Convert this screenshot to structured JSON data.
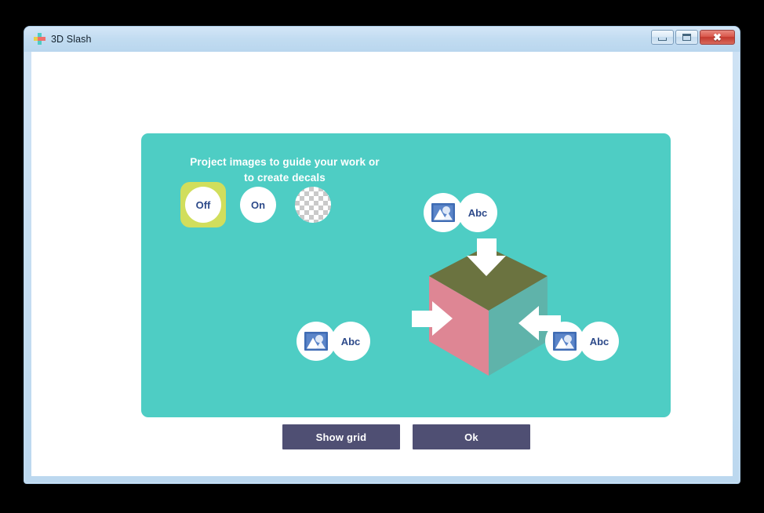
{
  "window": {
    "title": "3D Slash",
    "logo_icon": "3d-slash-pixel-logo",
    "controls": {
      "minimize": {
        "icon": "minimize-icon",
        "label": ""
      },
      "maximize": {
        "icon": "maximize-icon",
        "label": ""
      },
      "close": {
        "icon": "close-icon",
        "label": "✖"
      }
    }
  },
  "dialog": {
    "title_line1": "Project images to guide your work or",
    "title_line2": "to create decals",
    "accent_teal": "#4ecdc4",
    "accent_highlight": "#d1de5c",
    "button_color": "#4f4f73",
    "modes": [
      {
        "label": "Off",
        "name": "mode-off",
        "selected": true,
        "style": "text"
      },
      {
        "label": "On",
        "name": "mode-on",
        "selected": false,
        "style": "text"
      },
      {
        "label": "",
        "name": "mode-transparency",
        "selected": false,
        "style": "checkerboard"
      }
    ],
    "projection_badges": [
      {
        "position": "top",
        "image_icon": "picture-icon",
        "text_label": "Abc"
      },
      {
        "position": "left",
        "image_icon": "picture-icon",
        "text_label": "Abc"
      },
      {
        "position": "right",
        "image_icon": "picture-icon",
        "text_label": "Abc"
      }
    ],
    "cube": {
      "name": "3d-cube-illustration",
      "top_face_color": "#6b7340",
      "left_face_color": "#de8694",
      "right_face_color": "#5fb3aa",
      "arrow_color": "#ffffff",
      "arrow_count": 3
    },
    "buttons": [
      {
        "label": "Show grid",
        "name": "show-grid-button"
      },
      {
        "label": "Ok",
        "name": "ok-button"
      }
    ]
  }
}
